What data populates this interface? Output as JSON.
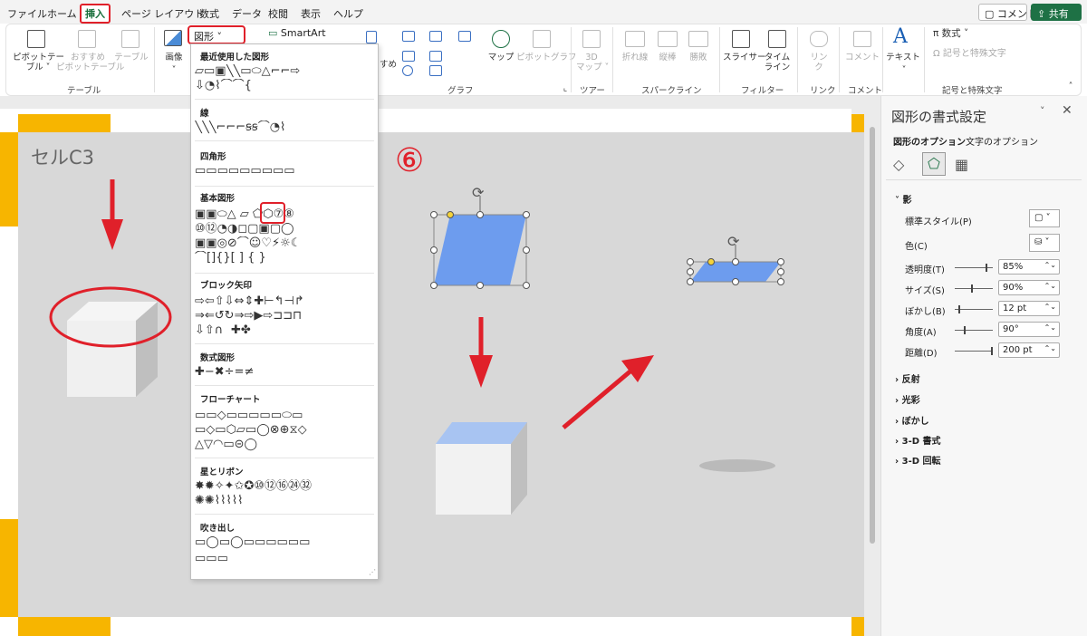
{
  "menu_tabs": [
    "ファイル",
    "ホーム",
    "挿入",
    "ページ レイアウト",
    "数式",
    "データ",
    "校閲",
    "表示",
    "ヘルプ"
  ],
  "active_tab": "挿入",
  "top_buttons": {
    "comment": "コメント",
    "share": "共有"
  },
  "ribbon": {
    "pivot_table": "ピボットテー\nブル ˅",
    "recommended_pivot": "おすすめ\nピボットテーブル",
    "table": "テーブル",
    "image": "画像",
    "shapes_button": "図形 ˅",
    "smartart": "SmartArt",
    "map": "マップ",
    "pivot_chart": "ピボットグラフ",
    "map3d": "3D\nマップ ˅",
    "line": "折れ線",
    "column": "縦棒",
    "winloss": "勝敗",
    "slicer": "スライサー",
    "timeline": "タイム\nライン",
    "link": "リン\nク",
    "comment": "コメント",
    "text": "テキスト",
    "equation": "π 数式 ˅",
    "symbol": "Ω 記号と特殊文字",
    "groups": [
      "テーブル",
      "グラフ",
      "ツアー",
      "スパークライン",
      "フィルター",
      "リンク",
      "コメント",
      "記号と特殊文字"
    ],
    "partial_label": "すめ"
  },
  "shapes_menu": {
    "sections": [
      "最近使用した図形",
      "線",
      "四角形",
      "基本図形",
      "ブロック矢印",
      "数式図形",
      "フローチャート",
      "星とリボン",
      "吹き出し"
    ],
    "rows": {
      "recent1": "▱▭▣╲╲▭⬭△⌐⌐⇨",
      "recent2": "⇩◔⌇⌒⌒{",
      "lines": "╲╲╲⌐⌐⌐ꞩꞩ⌒◔⌇",
      "rects": "▭▭▭▭▭▭▭▭▭",
      "basic1": "▣▣⬭△ ▱ ⬠⬡⑦⑧",
      "basic2": "⑩⑫◔◑◻▢▣▢◯",
      "basic3": "▣▣◎⊘⌒☺♡⚡☼☾",
      "basic4": "⌒[]{}[ ] { }",
      "block1": "⇨⇦⇧⇩⇔⇕✚⊢↰⊣↱",
      "block2": "⇒⇐↺↻⇒⇨▶⇨⊐⊐⊓",
      "block3": "⇩⇧∩",
      "block4": "✚✤",
      "math": "✚−✖÷=≠",
      "flow1": "▭▭◇▭▭▭▭▭⬭▭",
      "flow2": "▭◇▭⬡▱▭◯⊗⊕⧖◇",
      "flow3": "△▽◠▭⊝◯",
      "star1": "✸✹✧✦✩✪⑩⑫⑯㉔㉜",
      "star2": "✺✺⌇⌇⌇⌇⌇",
      "call1": "▭◯▭◯▭▭▭▭▭▭",
      "call2": "▭▭▭"
    }
  },
  "canvas": {
    "cell_label": "セルC3",
    "step_number": "⑥"
  },
  "format_panel": {
    "title": "図形の書式設定",
    "tab_shape_options": "図形のオプション",
    "tab_text_options": "文字のオプション",
    "shadow_section": "影",
    "properties": [
      {
        "label": "標準スタイル(P)",
        "value": ""
      },
      {
        "label": "色(C)",
        "value": ""
      },
      {
        "label": "透明度(T)",
        "value": "85%"
      },
      {
        "label": "サイズ(S)",
        "value": "90%"
      },
      {
        "label": "ぼかし(B)",
        "value": "12 pt"
      },
      {
        "label": "角度(A)",
        "value": "90°"
      },
      {
        "label": "距離(D)",
        "value": "200 pt"
      }
    ],
    "collapsed_sections": [
      "反射",
      "光彩",
      "ぼかし",
      "3-D 書式",
      "3-D 回転"
    ]
  },
  "colors": {
    "accent_red": "#e0202a",
    "excel_green": "#1e7145",
    "shape_blue": "#6d9cee",
    "cube_face": "#f2f2f2",
    "yellow": "#f7b500"
  }
}
